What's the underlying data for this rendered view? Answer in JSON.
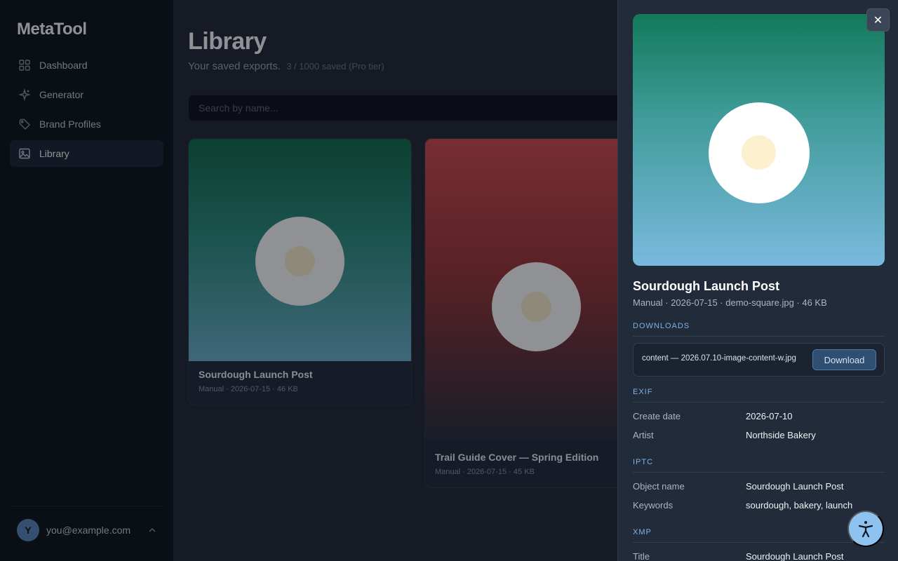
{
  "app": {
    "name": "MetaTool"
  },
  "sidebar": {
    "items": [
      {
        "label": "Dashboard",
        "icon": "grid-icon"
      },
      {
        "label": "Generator",
        "icon": "sparkle-icon"
      },
      {
        "label": "Brand Profiles",
        "icon": "tag-icon"
      },
      {
        "label": "Library",
        "icon": "image-icon",
        "active": true
      }
    ],
    "user": {
      "initial": "Y",
      "email": "you@example.com"
    }
  },
  "main": {
    "title": "Library",
    "subtitle": "Your saved exports.",
    "count": "3 / 1000 saved (Pro tier)",
    "search_placeholder": "Search by name...",
    "cards": [
      {
        "title": "Sourdough Launch Post",
        "meta": "Manual · 2026-07-15 · 46 KB",
        "colors": [
          "#0f6b4a",
          "#6cb3cf"
        ]
      },
      {
        "title": "Trail Guide Cover — Spring Edition",
        "meta": "Manual · 2026-07-15 · 45 KB",
        "colors": [
          "#d04c4c",
          "#262d3b"
        ]
      }
    ]
  },
  "drawer": {
    "close_label": "✕",
    "title": "Sourdough Launch Post",
    "meta": "Manual · 2026-07-15 · demo-square.jpg · 46 KB",
    "downloads_label": "DOWNLOADS",
    "download_file": "content — 2026.07.10-image-content-w.jpg",
    "download_button": "Download",
    "exif_label": "EXIF",
    "exif": [
      {
        "key": "Create date",
        "value": "2026-07-10"
      },
      {
        "key": "Artist",
        "value": "Northside Bakery"
      }
    ],
    "iptc_label": "IPTC",
    "iptc": [
      {
        "key": "Object name",
        "value": "Sourdough Launch Post"
      },
      {
        "key": "Keywords",
        "value": "sourdough, bakery, launch"
      }
    ],
    "xmp_label": "XMP",
    "xmp": [
      {
        "key": "Title",
        "value": "Sourdough Launch Post"
      }
    ]
  },
  "colors": {
    "accent": "#7fb3e6",
    "a11y_button": "#8fc3ef"
  }
}
